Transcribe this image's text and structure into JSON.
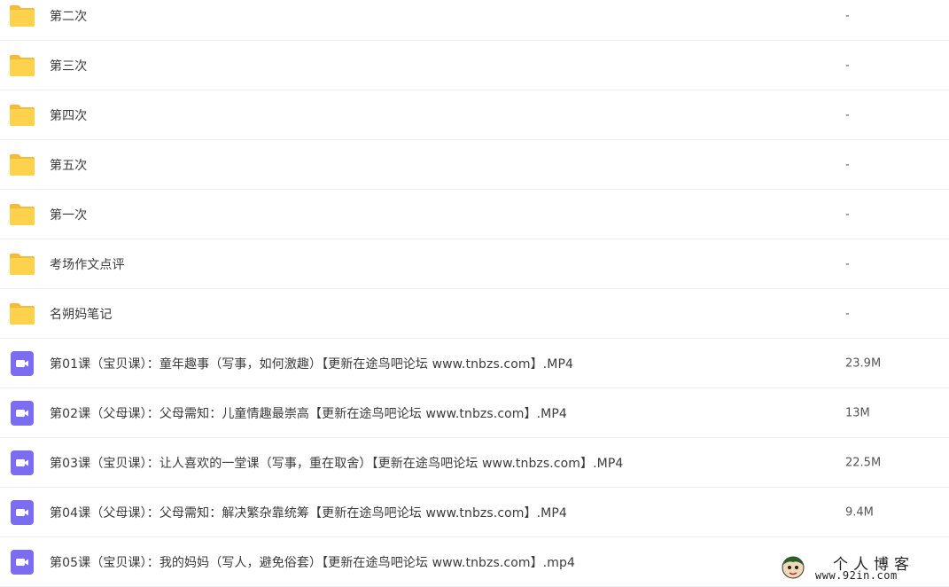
{
  "rows": [
    {
      "kind": "folder",
      "name": "第二次",
      "size": "-"
    },
    {
      "kind": "folder",
      "name": "第三次",
      "size": "-"
    },
    {
      "kind": "folder",
      "name": "第四次",
      "size": "-"
    },
    {
      "kind": "folder",
      "name": "第五次",
      "size": "-"
    },
    {
      "kind": "folder",
      "name": "第一次",
      "size": "-"
    },
    {
      "kind": "folder",
      "name": "考场作文点评",
      "size": "-"
    },
    {
      "kind": "folder",
      "name": "名朔妈笔记",
      "size": "-"
    },
    {
      "kind": "video",
      "name": "第01课（宝贝课）：童年趣事（写事，如何激趣）【更新在途鸟吧论坛 www.tnbzs.com】.MP4",
      "size": "23.9M"
    },
    {
      "kind": "video",
      "name": "第02课（父母课）：父母需知：儿童情趣最崇高【更新在途鸟吧论坛 www.tnbzs.com】.MP4",
      "size": "13M"
    },
    {
      "kind": "video",
      "name": "第03课（宝贝课）：让人喜欢的一堂课（写事，重在取舍）【更新在途鸟吧论坛 www.tnbzs.com】.MP4",
      "size": "22.5M"
    },
    {
      "kind": "video",
      "name": "第04课（父母课）：父母需知：解决繁杂靠统筹【更新在途鸟吧论坛 www.tnbzs.com】.MP4",
      "size": "9.4M"
    },
    {
      "kind": "video",
      "name": "第05课（宝贝课）：我的妈妈（写人，避免俗套）【更新在途鸟吧论坛 www.tnbzs.com】.mp4",
      "size": ""
    }
  ],
  "icons": {
    "folder": "folder-icon",
    "video": "video-file-icon"
  },
  "colors": {
    "folder": "#FFD24D",
    "video": "#7B6CF0",
    "divider": "#f0f1f3"
  },
  "watermark": {
    "title": "个人博客",
    "url": "www.92in.com"
  }
}
